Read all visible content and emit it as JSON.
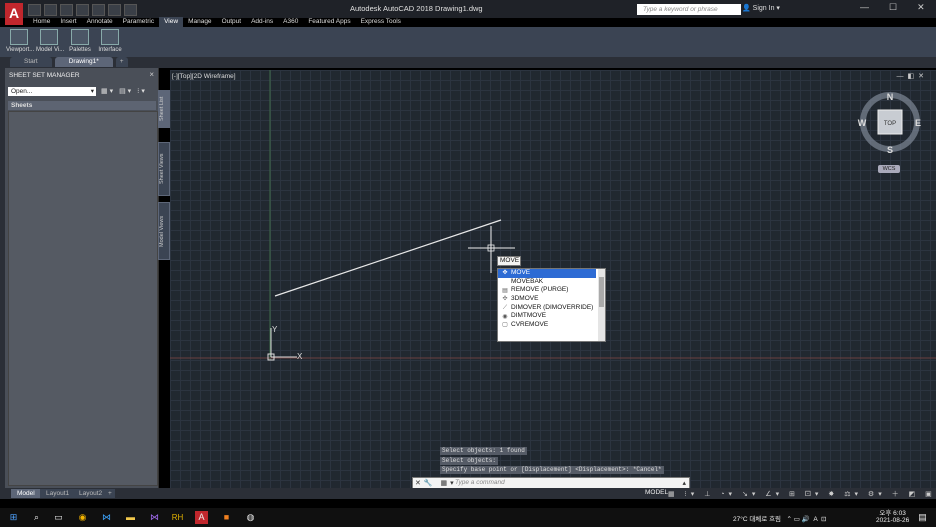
{
  "app": {
    "logo_letter": "A",
    "title": "Autodesk AutoCAD 2018    Drawing1.dwg",
    "search_placeholder": "Type a keyword or phrase",
    "signin": "Sign In"
  },
  "ribbon": {
    "tabs": [
      "Home",
      "Insert",
      "Annotate",
      "Parametric",
      "View",
      "Manage",
      "Output",
      "Add-ins",
      "A360",
      "Featured Apps",
      "Express Tools"
    ],
    "active_tab": "View",
    "buttons": [
      "Viewport...",
      "Model Vi...",
      "Palettes",
      "Interface"
    ]
  },
  "file_tabs": [
    "Start",
    "Drawing1*",
    "+"
  ],
  "sheet_set_manager": {
    "title": "SHEET SET MANAGER",
    "dropdown_value": "Open...",
    "sheets_header": "Sheets",
    "vertical_tabs": [
      "Sheet List",
      "Sheet Views",
      "Model Views"
    ]
  },
  "viewport": {
    "label": "[-][Top][2D Wireframe]",
    "viewcube": {
      "n": "N",
      "s": "S",
      "e": "E",
      "w": "W",
      "face": "TOP"
    },
    "wcs": "WCS",
    "ucs_x": "X",
    "ucs_y": "Y"
  },
  "autocomplete": {
    "typed": "MOVE",
    "items": [
      {
        "label": "MOVE",
        "icon": "move-icon",
        "selected": true
      },
      {
        "label": "MOVEBAK",
        "icon": "",
        "selected": false
      },
      {
        "label": "REMOVE (PURGE)",
        "icon": "purge-icon",
        "selected": false
      },
      {
        "label": "3DMOVE",
        "icon": "3dmove-icon",
        "selected": false
      },
      {
        "label": "DIMOVER (DIMOVERRIDE)",
        "icon": "dimoverride-icon",
        "selected": false
      },
      {
        "label": "DIMTMOVE",
        "icon": "dimtmove-icon",
        "selected": false
      },
      {
        "label": "CVREMOVE",
        "icon": "cvremove-icon",
        "selected": false
      }
    ]
  },
  "command": {
    "history": [
      "Select objects: 1 found",
      "Select objects:",
      "Specify base point or [Displacement] <Displacement>: *Cancel*"
    ],
    "placeholder": "Type a command"
  },
  "layout_tabs": [
    "Model",
    "Layout1",
    "Layout2",
    "+"
  ],
  "status": {
    "model": "MODEL"
  },
  "taskbar": {
    "weather": "27°C  대체로 흐림",
    "lang": "A",
    "time": "오후 6:03",
    "date": "2021-08-26"
  }
}
